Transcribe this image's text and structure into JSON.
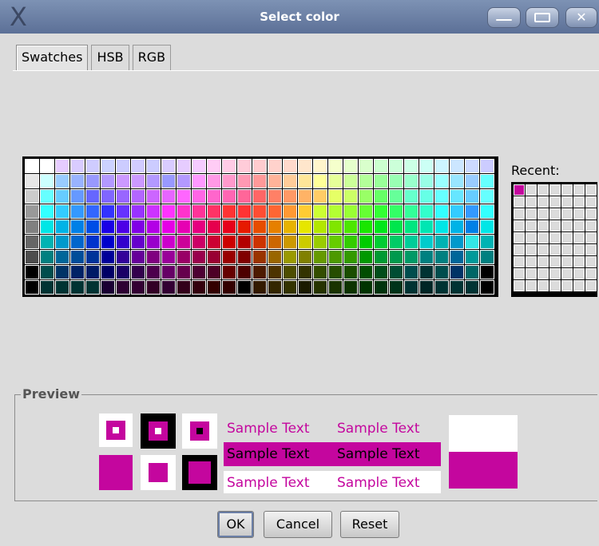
{
  "window": {
    "title": "Select color",
    "logo": "X"
  },
  "tabs": [
    {
      "label": "Swatches",
      "active": true
    },
    {
      "label": "HSB",
      "active": false
    },
    {
      "label": "RGB",
      "active": false
    }
  ],
  "recent": {
    "label": "Recent:",
    "colors": [
      "#c4069e"
    ]
  },
  "preview": {
    "label": "Preview",
    "sample_text": "Sample Text",
    "color": "#c4069e"
  },
  "buttons": {
    "ok": "OK",
    "cancel": "Cancel",
    "reset": "Reset"
  },
  "icons": {
    "minimize": "minimize-icon",
    "maximize": "maximize-icon",
    "close": "close-icon"
  },
  "swatch_rows": [
    [
      "#ffffff",
      "#ffffff",
      "#e6ccff",
      "#d9ccff",
      "#cfccff",
      "#ccd2ff",
      "#ccccff",
      "#d2ccff",
      "#ccccff",
      "#d9ccff",
      "#e6ccff",
      "#f5ccff",
      "#ffccf5",
      "#ffcce6",
      "#ffccd9",
      "#ffcccf",
      "#ffd2cc",
      "#ffd9cc",
      "#ffe6cc",
      "#fff5cc",
      "#f5ffcc",
      "#e6ffcc",
      "#d9ffcc",
      "#ccffcf",
      "#ccffd9",
      "#ccffe6",
      "#ccfff5",
      "#ccf5ff",
      "#cce6ff",
      "#ccd9ff",
      "#ccccff"
    ],
    [
      "#e6e6e6",
      "#ccffff",
      "#99ccff",
      "#99b3ff",
      "#9999ff",
      "#b399ff",
      "#cc99ff",
      "#cc99ff",
      "#b399ff",
      "#9999ff",
      "#b399ff",
      "#ff99ff",
      "#ff99e6",
      "#ff99cc",
      "#ff99b3",
      "#ff9999",
      "#ffb399",
      "#ffcc99",
      "#ffe699",
      "#ffff99",
      "#e6ff99",
      "#ccff99",
      "#b3ff99",
      "#99ff99",
      "#99ffb3",
      "#99ffcc",
      "#99ffe6",
      "#99ffff",
      "#99e6ff",
      "#99ccff",
      "#66ffff"
    ],
    [
      "#cccccc",
      "#66ffff",
      "#66ccff",
      "#6699ff",
      "#6666ff",
      "#8066ff",
      "#9966ff",
      "#b366ff",
      "#cc66ff",
      "#e666ff",
      "#ff66ff",
      "#ff66e6",
      "#ff66cc",
      "#ff66b3",
      "#ff6699",
      "#ff6666",
      "#ff8066",
      "#ff9966",
      "#ffb366",
      "#ffcc66",
      "#e6ff66",
      "#ccff66",
      "#99ff66",
      "#66ff66",
      "#66ff99",
      "#66ffcc",
      "#66ffe6",
      "#66ffff",
      "#66e6ff",
      "#66ccff",
      "#66ffff"
    ],
    [
      "#999999",
      "#33ffff",
      "#33ccff",
      "#3399ff",
      "#3366ff",
      "#3333ff",
      "#6633ff",
      "#9933ff",
      "#cc33ff",
      "#ff33ff",
      "#ff33cc",
      "#ff3399",
      "#ff3366",
      "#ff3333",
      "#ff3333",
      "#ff4d33",
      "#ff6633",
      "#ff9933",
      "#ffcc33",
      "#ccff33",
      "#b3ff33",
      "#99ff33",
      "#66ff33",
      "#33ff33",
      "#33ff66",
      "#33ff99",
      "#33ffcc",
      "#33ffff",
      "#33ccff",
      "#3399ff",
      "#33ffff"
    ],
    [
      "#808080",
      "#00e6e6",
      "#00b3e6",
      "#0080e6",
      "#004de6",
      "#1a00e6",
      "#4d00e6",
      "#8000e6",
      "#b300e6",
      "#e600e6",
      "#e600b3",
      "#e60080",
      "#e6004d",
      "#e6001a",
      "#e61a00",
      "#e64d00",
      "#e68000",
      "#e6b300",
      "#e6e600",
      "#b3e600",
      "#80e600",
      "#4de600",
      "#1ae600",
      "#00e61a",
      "#00e64d",
      "#00e680",
      "#00e6b3",
      "#00e6e6",
      "#00b3e6",
      "#0080e6",
      "#00e6e6"
    ],
    [
      "#666666",
      "#00b3b3",
      "#0099cc",
      "#0066cc",
      "#0033cc",
      "#0000cc",
      "#3300cc",
      "#6600cc",
      "#9900cc",
      "#cc00cc",
      "#cc0099",
      "#cc0066",
      "#cc0033",
      "#cc0000",
      "#b30000",
      "#cc3300",
      "#cc6600",
      "#cc9900",
      "#cccc00",
      "#99cc00",
      "#66cc00",
      "#33cc00",
      "#00cc00",
      "#00cc33",
      "#00cc66",
      "#00cc99",
      "#00cccc",
      "#00b3b3",
      "#0099cc",
      "#33e6e6",
      "#00b3b3"
    ],
    [
      "#4d4d4d",
      "#008080",
      "#006699",
      "#004d99",
      "#003399",
      "#000099",
      "#330099",
      "#660099",
      "#800080",
      "#990099",
      "#990066",
      "#99004d",
      "#990033",
      "#990000",
      "#800000",
      "#993300",
      "#996600",
      "#999900",
      "#808000",
      "#669900",
      "#4d9900",
      "#339900",
      "#009900",
      "#009933",
      "#00994d",
      "#009966",
      "#008080",
      "#008080",
      "#006699",
      "#009999",
      "#008080"
    ],
    [
      "#000000",
      "#004d4d",
      "#003366",
      "#002266",
      "#001a66",
      "#000066",
      "#1a0066",
      "#33004d",
      "#4d004d",
      "#660066",
      "#66004d",
      "#4d0033",
      "#4d0026",
      "#660000",
      "#4d0000",
      "#4d1a00",
      "#4d3300",
      "#4d4d00",
      "#333300",
      "#334d00",
      "#264d00",
      "#1a4d00",
      "#004d00",
      "#004d1a",
      "#004d33",
      "#004d4d",
      "#003333",
      "#004d4d",
      "#003366",
      "#006666",
      "#000000"
    ],
    [
      "#000000",
      "#003333",
      "#003333",
      "#003333",
      "#003333",
      "#1a0033",
      "#2e0033",
      "#330033",
      "#330026",
      "#330033",
      "#33001a",
      "#33000d",
      "#330000",
      "#330000",
      "#000000",
      "#331a00",
      "#332600",
      "#333300",
      "#1a1a00",
      "#263300",
      "#1a3300",
      "#0d3300",
      "#003300",
      "#00330d",
      "#003319",
      "#003333",
      "#002626",
      "#003333",
      "#003333",
      "#003333",
      "#000000"
    ]
  ]
}
